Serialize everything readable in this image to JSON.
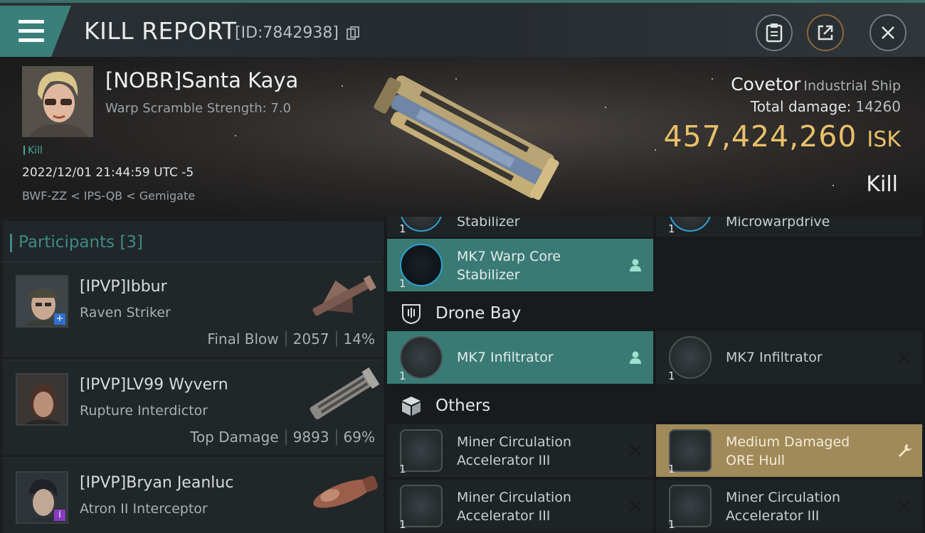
{
  "header": {
    "title": "KILL REPORT",
    "id_label": "[ID:7842938]"
  },
  "victim": {
    "name": "[NOBR]Santa Kaya",
    "warp_scramble": "Warp Scramble Strength: 7.0",
    "tag": "Kill",
    "datetime": "2022/12/01 21:44:59 UTC -5",
    "route": "BWF-ZZ < IPS-QB < Gemigate",
    "ship": "Covetor",
    "ship_class": "Industrial Ship",
    "total_damage_label": "Total damage:",
    "total_damage": "14260",
    "isk_value": "457,424,260",
    "isk_unit": "ISK",
    "result": "Kill"
  },
  "participants": {
    "title": "Participants",
    "count": "[3]",
    "rows": [
      {
        "name": "[IPVP]Ibbur",
        "ship": "Raven Striker",
        "role": "Final Blow",
        "damage": "2057",
        "percent": "14%",
        "badge": "+"
      },
      {
        "name": "[IPVP]LV99 Wyvern",
        "ship": "Rupture Interdictor",
        "role": "Top Damage",
        "damage": "9893",
        "percent": "69%",
        "badge": ""
      },
      {
        "name": "[IPVP]Bryan Jeanluc",
        "ship": "Atron II Interceptor",
        "role": "",
        "damage": "",
        "percent": "",
        "badge": "i"
      }
    ]
  },
  "items": {
    "partial_top_left": "Stabilizer",
    "partial_top_right": "Microwarpdrive",
    "warp_core": "MK7 Warp Core Stabilizer",
    "warp_core_line1": "MK7 Warp Core",
    "warp_core_line2": "Stabilizer",
    "drone_bay_label": "Drone Bay",
    "drone_1": "MK7  Infiltrator",
    "drone_2": "MK7  Infiltrator",
    "others_label": "Others",
    "other_1_line1": "Miner Circulation",
    "other_1_line2": "Accelerator III",
    "other_2_line1": "Medium Damaged",
    "other_2_line2": "ORE Hull",
    "other_3_line1": "Miner Circulation",
    "other_3_line2": "Accelerator III",
    "other_4_line1": "Miner Circulation",
    "other_4_line2": "Accelerator III",
    "qty": "1"
  },
  "colors": {
    "accent_teal": "#3a7f79",
    "isk_gold": "#e8c06a",
    "dropped_green": "#3a7a74",
    "damaged_gold": "#a08a5a"
  }
}
